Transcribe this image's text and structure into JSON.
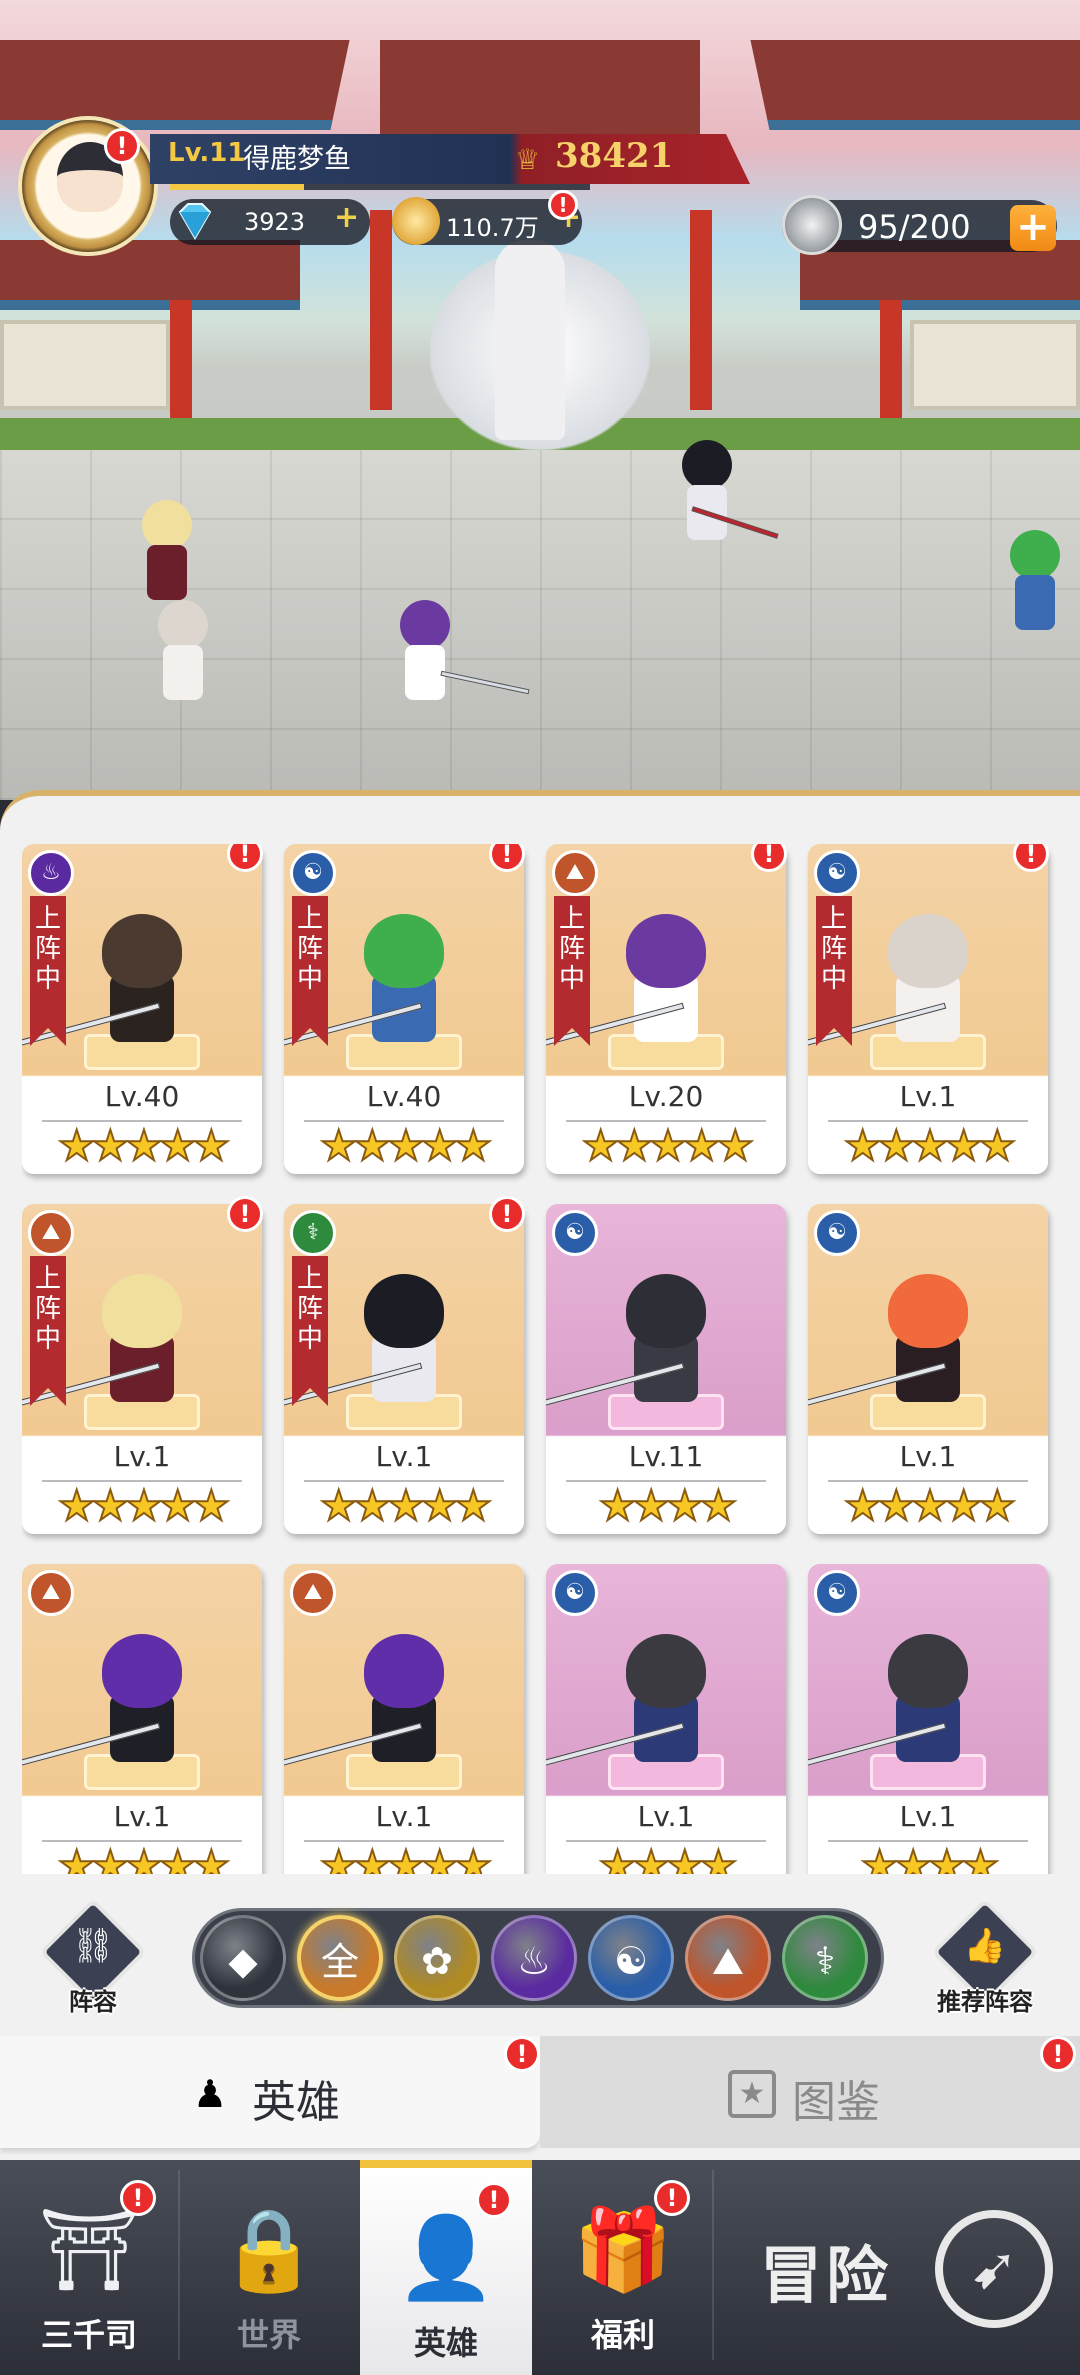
{
  "hud": {
    "level": "Lv.11",
    "player_name": "得鹿梦鱼",
    "power": "38421",
    "gems": "3923",
    "gold": "110.7万",
    "stamina": "95/200",
    "xp_progress": 0.32
  },
  "heroes": [
    {
      "level": "Lv.40",
      "stars": "★★★★★",
      "element": "fire",
      "deployed": true,
      "alert": true,
      "variant": "gold",
      "hair": "#4a3a30",
      "outfit": "#2b2320"
    },
    {
      "level": "Lv.40",
      "stars": "★★★★★",
      "element": "water",
      "deployed": true,
      "alert": true,
      "variant": "gold",
      "hair": "#3fae4c",
      "outfit": "#3a6ab2"
    },
    {
      "level": "Lv.20",
      "stars": "★★★★★",
      "element": "earth",
      "deployed": true,
      "alert": true,
      "variant": "gold",
      "hair": "#6b3aa0",
      "outfit": "#ffffff"
    },
    {
      "level": "Lv.1",
      "stars": "★★★★★",
      "element": "water",
      "deployed": true,
      "alert": true,
      "variant": "gold",
      "hair": "#d9d3cc",
      "outfit": "#f4f0ee"
    },
    {
      "level": "Lv.1",
      "stars": "★★★★★",
      "element": "earth",
      "deployed": true,
      "alert": true,
      "variant": "gold",
      "hair": "#f1df9e",
      "outfit": "#6b1f2b"
    },
    {
      "level": "Lv.1",
      "stars": "★★★★★",
      "element": "life",
      "deployed": true,
      "alert": true,
      "variant": "gold",
      "hair": "#1c1c24",
      "outfit": "#e9e9ef"
    },
    {
      "level": "Lv.11",
      "stars": "★★★★",
      "element": "water",
      "deployed": false,
      "alert": false,
      "variant": "purple",
      "hair": "#2e2e36",
      "outfit": "#3a3a44"
    },
    {
      "level": "Lv.1",
      "stars": "★★★★★",
      "element": "water",
      "deployed": false,
      "alert": false,
      "variant": "gold",
      "hair": "#f06a3c",
      "outfit": "#2a1e22"
    },
    {
      "level": "Lv.1",
      "stars": "★★★★★",
      "element": "earth",
      "deployed": false,
      "alert": false,
      "variant": "gold",
      "hair": "#5f2ea8",
      "outfit": "#1f1f28"
    },
    {
      "level": "Lv.1",
      "stars": "★★★★★",
      "element": "earth",
      "deployed": false,
      "alert": false,
      "variant": "gold",
      "hair": "#5f2ea8",
      "outfit": "#1f1f28"
    },
    {
      "level": "Lv.1",
      "stars": "★★★★",
      "element": "water",
      "deployed": false,
      "alert": false,
      "variant": "purple",
      "hair": "#3a3a40",
      "outfit": "#2c3b78"
    },
    {
      "level": "Lv.1",
      "stars": "★★★★",
      "element": "water",
      "deployed": false,
      "alert": false,
      "variant": "purple",
      "hair": "#3a3a40",
      "outfit": "#2c3b78"
    }
  ],
  "deployed_label": "上阵中",
  "alert_glyph": "!",
  "elements": {
    "fire": {
      "glyph": "♨",
      "color": "#5a2aa0"
    },
    "water": {
      "glyph": "☯",
      "color": "#2a5ea8"
    },
    "earth": {
      "glyph": "⛰",
      "color": "#c0542a"
    },
    "life": {
      "glyph": "⚕",
      "color": "#2e8a3c"
    }
  },
  "lineup_button": {
    "label": "阵容"
  },
  "recommend_button": {
    "label": "推荐阵容"
  },
  "filters": [
    {
      "id": "class",
      "glyph": "◆",
      "color": "#2f333c"
    },
    {
      "id": "all",
      "glyph": "全",
      "color": "#c87a2a",
      "selected": true
    },
    {
      "id": "light",
      "glyph": "✿",
      "color": "#b08a22"
    },
    {
      "id": "fire",
      "glyph": "♨",
      "color": "#5a2aa0"
    },
    {
      "id": "water",
      "glyph": "☯",
      "color": "#2a5ea8"
    },
    {
      "id": "earth",
      "glyph": "⛰",
      "color": "#c0542a"
    },
    {
      "id": "life",
      "glyph": "⚕",
      "color": "#2e8a3c"
    }
  ],
  "tabs": {
    "heroes": "英雄",
    "codex": "图鉴"
  },
  "nav": {
    "items": [
      {
        "label": "三千司",
        "icon": "temple-icon",
        "glyph": "⛩"
      },
      {
        "label": "世界",
        "icon": "locked-world-icon",
        "glyph": "🔒"
      },
      {
        "label": "英雄",
        "icon": "hero-icon",
        "glyph": "👤"
      },
      {
        "label": "福利",
        "icon": "gift-box-icon",
        "glyph": "🎁"
      }
    ],
    "adventure": "冒险"
  }
}
